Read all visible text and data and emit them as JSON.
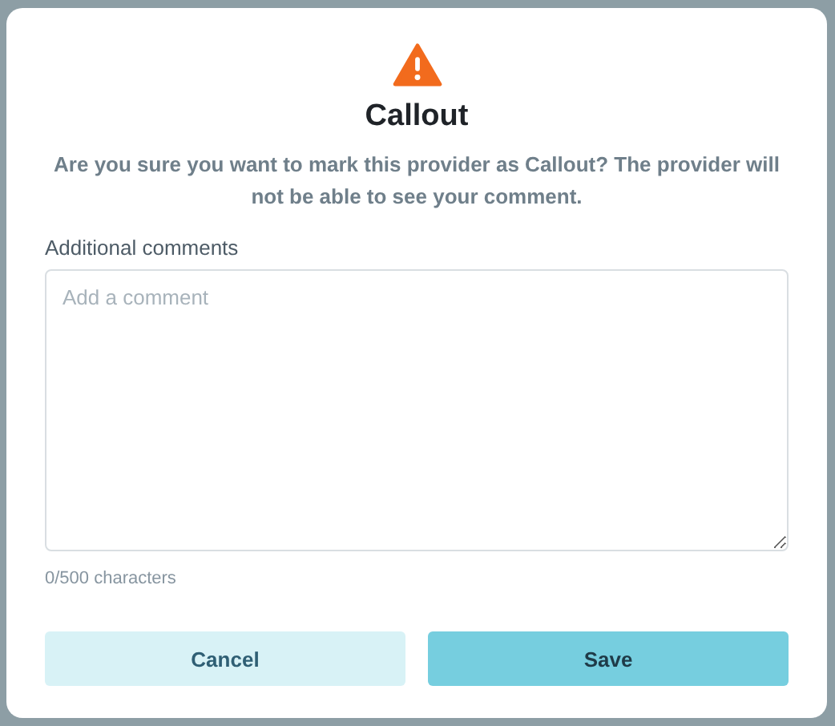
{
  "dialog": {
    "title": "Callout",
    "message": "Are you sure you want to mark this provider as Callout? The provider will not be able to see your comment.",
    "field_label": "Additional comments",
    "comment": {
      "placeholder": "Add a comment"
    },
    "counter": "0/500 characters",
    "buttons": [
      {
        "label": "Cancel",
        "kind": "secondary"
      },
      {
        "label": "Save",
        "kind": "primary"
      }
    ]
  }
}
